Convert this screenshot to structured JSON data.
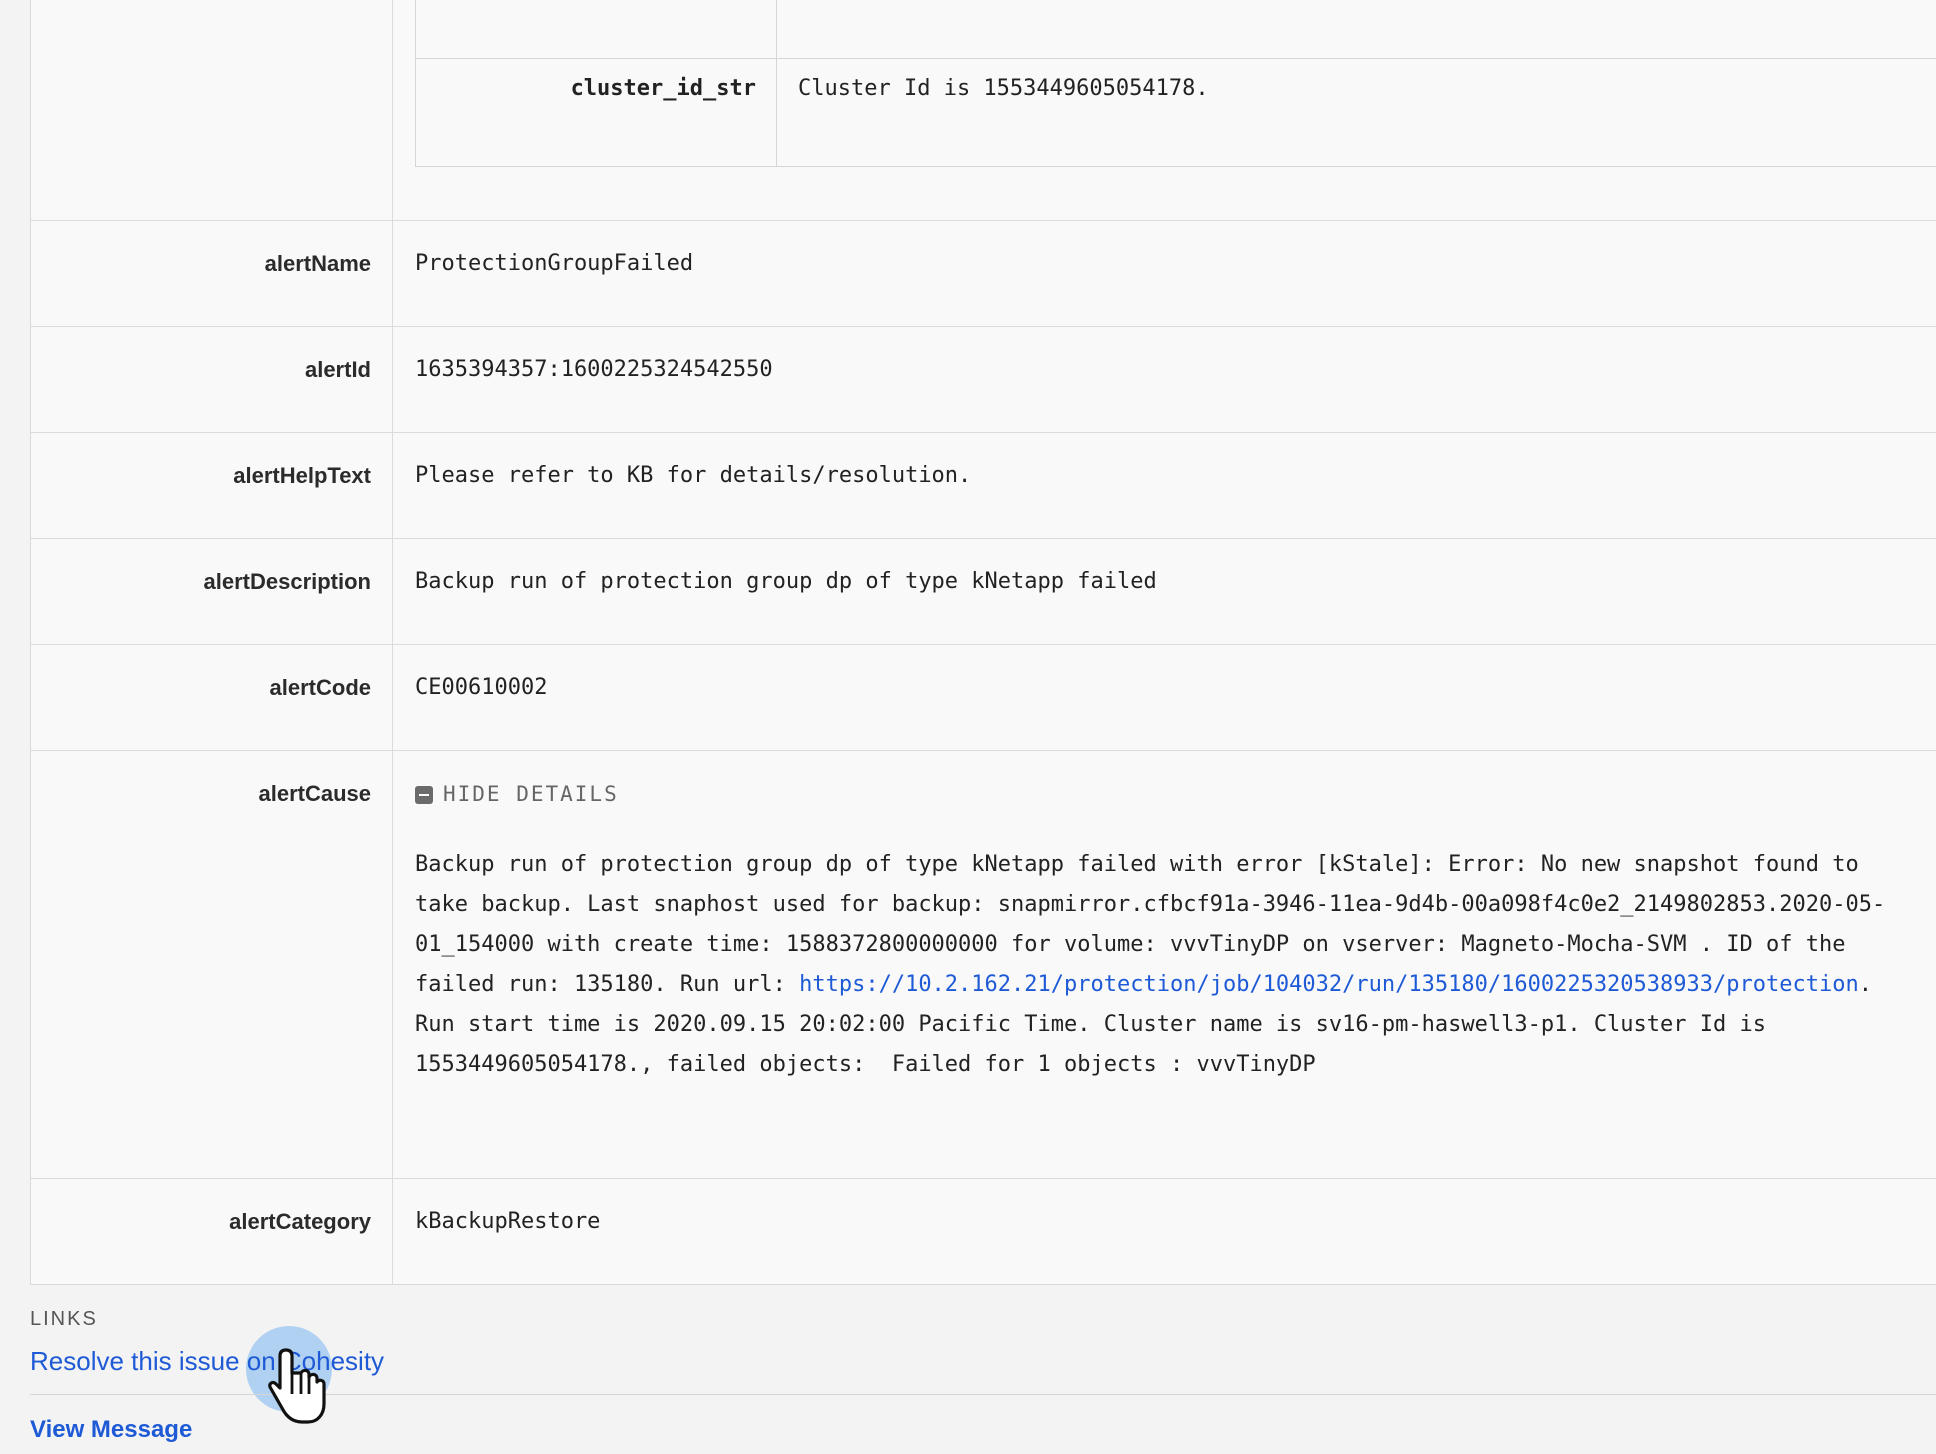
{
  "nested_table": {
    "key": "cluster_id_str",
    "value": "Cluster Id is 1553449605054178."
  },
  "rows": {
    "alertName": {
      "key": "alertName",
      "value": "ProtectionGroupFailed"
    },
    "alertId": {
      "key": "alertId",
      "value": "1635394357:1600225324542550"
    },
    "alertHelpText": {
      "key": "alertHelpText",
      "value": "Please refer to KB for details/resolution."
    },
    "alertDescription": {
      "key": "alertDescription",
      "value": "Backup run of protection group dp of type kNetapp failed"
    },
    "alertCode": {
      "key": "alertCode",
      "value": "CE00610002"
    },
    "alertCause": {
      "key": "alertCause",
      "toggle_label": "HIDE DETAILS",
      "text_before_link": "Backup run of protection group dp of type kNetapp failed with error [kStale]: Error: No new snapshot found to take backup. Last snaphost used for backup: snapmirror.cfbcf91a-3946-11ea-9d4b-00a098f4c0e2_2149802853.2020-05-01_154000 with create time: 1588372800000000 for volume: vvvTinyDP on vserver: Magneto-Mocha-SVM . ID of the failed run: 135180. Run url: ",
      "link": "https://10.2.162.21/protection/job/104032/run/135180/1600225320538933/protection",
      "text_after_link": ". Run start time is 2020.09.15 20:02:00 Pacific Time. Cluster name is sv16-pm-haswell3-p1. Cluster Id is 1553449605054178., failed objects:  Failed for 1 objects : vvvTinyDP"
    },
    "alertCategory": {
      "key": "alertCategory",
      "value": "kBackupRestore"
    }
  },
  "links": {
    "label": "LINKS",
    "resolve": "Resolve this issue on Cohesity",
    "view_message": "View Message"
  },
  "icons": {
    "toggle": "minus-square-icon",
    "cursor": "hand-pointer-icon"
  },
  "colors": {
    "link": "#1e5ad6",
    "border": "#dcdcdc",
    "background": "#f9f9f9"
  }
}
